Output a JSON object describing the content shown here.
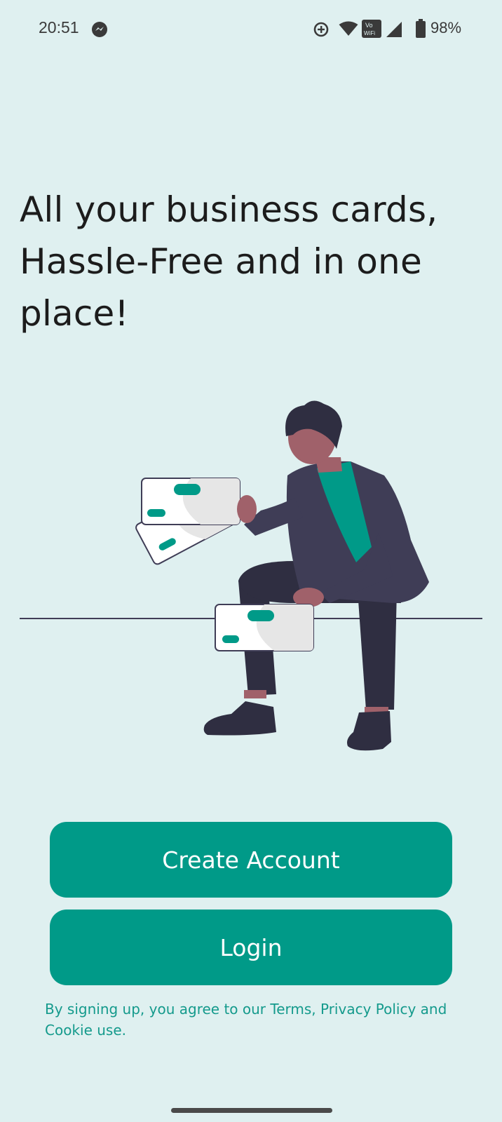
{
  "status_bar": {
    "time": "20:51",
    "battery_percent": "98%",
    "wifi_badge": "Vo WiFi",
    "icons": [
      "messenger-icon",
      "data-saver-icon",
      "wifi-icon",
      "vowifi-icon",
      "cellular-signal-icon",
      "battery-icon"
    ]
  },
  "onboarding": {
    "headline": "All your business cards, Hassle-Free and in one place!",
    "illustration": "person-holding-business-cards"
  },
  "actions": {
    "create_account_label": "Create Account",
    "login_label": "Login"
  },
  "legal": {
    "prefix": "By signing up, you agree to our ",
    "terms": "Terms",
    "separator": ", ",
    "privacy": "Privacy Policy",
    "and": " and ",
    "cookie": "Cookie use",
    "suffix": "."
  },
  "colors": {
    "background": "#dff0f0",
    "accent": "#009a88",
    "text_dark": "#1c1c1c",
    "legal_text": "#149a8c",
    "figure_jacket": "#3f3d56",
    "figure_skin": "#a0616a",
    "figure_dark": "#2f2e41"
  }
}
